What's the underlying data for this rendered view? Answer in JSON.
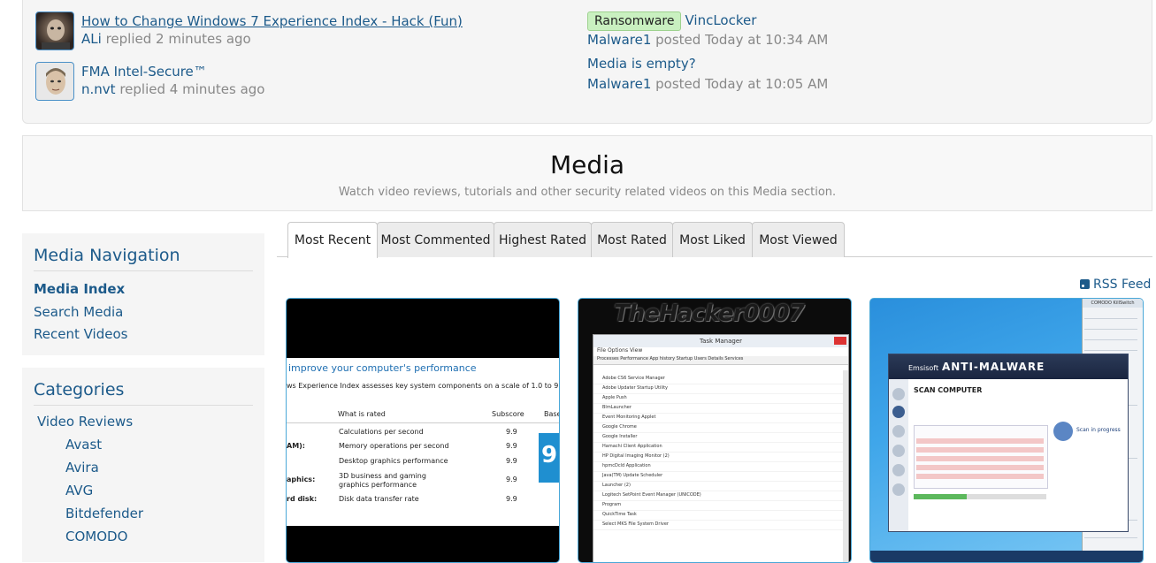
{
  "recent_threads_left": [
    {
      "title": "How to Change Windows 7 Experience Index - Hack (Fun)",
      "user": "ALi",
      "action": "replied",
      "time": "2 minutes ago"
    },
    {
      "title": "FMA Intel-Secure™",
      "user": "n.nvt",
      "action": "replied",
      "time": "4 minutes ago"
    }
  ],
  "recent_threads_right": [
    {
      "prefix": "Ransomware",
      "title": "VincLocker",
      "user": "Malware1",
      "action": "posted",
      "time": "Today at 10:34 AM"
    },
    {
      "prefix": "",
      "title": "Media is empty?",
      "user": "Malware1",
      "action": "posted",
      "time": "Today at 10:05 AM"
    }
  ],
  "media_header": {
    "title": "Media",
    "description": "Watch video reviews, tutorials and other security related videos on this Media section."
  },
  "media_navigation": {
    "heading": "Media Navigation",
    "items": [
      "Media Index",
      "Search Media",
      "Recent Videos"
    ]
  },
  "categories": {
    "heading": "Categories",
    "parent": "Video Reviews",
    "children": [
      "Avast",
      "Avira",
      "AVG",
      "Bitdefender",
      "COMODO"
    ]
  },
  "tabs": [
    "Most Recent",
    "Most Commented",
    "Highest Rated",
    "Most Rated",
    "Most Liked",
    "Most Viewed"
  ],
  "rss_label": "RSS Feed",
  "thumbnails": {
    "t1": {
      "title": "improve your computer's performance",
      "subtitle": "ws Experience Index assesses key system components on a scale of 1.0 to 9.9.",
      "col_rated": "What is rated",
      "col_subscore": "Subscore",
      "col_base": "Base",
      "rows": [
        {
          "label": "",
          "rated": "Calculations per second",
          "score": "9.9"
        },
        {
          "label": "AM):",
          "rated": "Memory operations per second",
          "score": "9.9"
        },
        {
          "label": "",
          "rated": "Desktop graphics performance",
          "score": "9.9"
        },
        {
          "label": "aphics:",
          "rated": "3D business and gaming graphics performance",
          "score": "9.9"
        },
        {
          "label": "rd disk:",
          "rated": "Disk data transfer rate",
          "score": "9.9"
        }
      ],
      "big_score": "9."
    },
    "t2": {
      "banner": "TheHacker0007",
      "window_title": "Task Manager",
      "menu": "File   Options   View",
      "tabs": "Processes  Performance  App history  Startup  Users  Details  Services",
      "rows": [
        "Adobe CS6 Service Manager",
        "Adobe Updater Startup Utility",
        "Apple Push",
        "BlmLauncher",
        "Event Monitoring Applet",
        "Google Chrome",
        "Google Installer",
        "Hamachi Client Application",
        "HP Digital Imaging Monitor (2)",
        "hpmcDcld Application",
        "Java(TM) Update Scheduler",
        "Launcher (2)",
        "Logitech SetPoint Event Manager (UNICODE)",
        "Program",
        "QuickTime Task",
        "Select MKS File System Driver"
      ]
    },
    "t3": {
      "comodo_title": "COMODO KillSwitch",
      "brand": "Emsisoft",
      "product": "ANTI-MALWARE",
      "subhead": "SCAN COMPUTER",
      "scan_text": "Scan in progress"
    }
  }
}
